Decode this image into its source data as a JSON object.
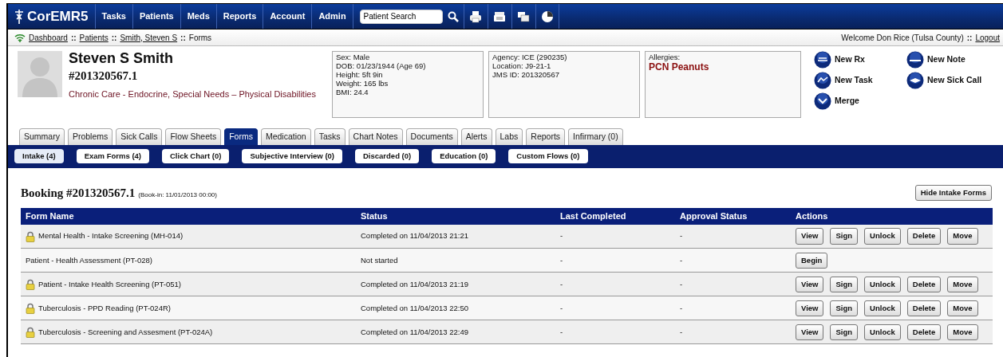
{
  "app": {
    "logo": "CorEMR5"
  },
  "nav": [
    {
      "label": "Tasks"
    },
    {
      "label": "Patients"
    },
    {
      "label": "Meds"
    },
    {
      "label": "Reports"
    },
    {
      "label": "Account"
    },
    {
      "label": "Admin"
    }
  ],
  "search": {
    "placeholder": "Patient Search"
  },
  "toolbar": [
    {
      "kind": "print"
    },
    {
      "kind": "fax"
    },
    {
      "kind": "queue"
    },
    {
      "kind": "stats"
    }
  ],
  "breadcrumb": [
    {
      "label": "Dashboard",
      "link": true
    },
    {
      "label": "Patients",
      "link": true
    },
    {
      "label": "Smith, Steven S",
      "link": true
    },
    {
      "label": "Forms",
      "link": false
    }
  ],
  "breadcrumb_separator": "::",
  "user": {
    "welcome": "Welcome Don Rice (Tulsa County)",
    "separator": "::",
    "logout": "Logout"
  },
  "patient": {
    "name": "Steven S Smith",
    "number": "#201320567.1",
    "conditions": "Chronic Care - Endocrine, Special Needs – Physical Disabilities"
  },
  "info_boxes": [
    {
      "lines": [
        "Sex: Male",
        "DOB: 01/23/1944 (Age 69)",
        "Height: 5ft 9in",
        "Weight: 165 lbs",
        "BMI: 24.4"
      ]
    },
    {
      "lines": [
        "Agency: ICE (290235)",
        "Location: J9-21-1",
        "JMS ID: 201320567"
      ]
    }
  ],
  "allergies": {
    "label": "Allergies:",
    "value": "PCN Peanuts"
  },
  "quick_actions": [
    {
      "label": "New Rx",
      "kind": "rx"
    },
    {
      "label": "New Note",
      "kind": "note"
    },
    {
      "label": "New Task",
      "kind": "task"
    },
    {
      "label": "New Sick Call",
      "kind": "sick"
    },
    {
      "label": "Merge",
      "kind": "merge"
    }
  ],
  "tabs": [
    {
      "label": "Summary",
      "selected": false
    },
    {
      "label": "Problems",
      "selected": false
    },
    {
      "label": "Sick Calls",
      "selected": false
    },
    {
      "label": "Flow Sheets",
      "selected": false
    },
    {
      "label": "Forms",
      "selected": true
    },
    {
      "label": "Medication",
      "selected": false
    },
    {
      "label": "Tasks",
      "selected": false
    },
    {
      "label": "Chart Notes",
      "selected": false
    },
    {
      "label": "Documents",
      "selected": false
    },
    {
      "label": "Alerts",
      "selected": false
    },
    {
      "label": "Labs",
      "selected": false
    },
    {
      "label": "Reports",
      "selected": false
    },
    {
      "label": "Infirmary (0)",
      "selected": false
    }
  ],
  "subtabs": [
    {
      "label": "Intake (4)",
      "selected": true
    },
    {
      "label": "Exam Forms (4)",
      "selected": false
    },
    {
      "label": "Click Chart (0)",
      "selected": false
    },
    {
      "label": "Subjective Interview (0)",
      "selected": false
    },
    {
      "label": "Discarded (0)",
      "selected": false
    },
    {
      "label": "Education (0)",
      "selected": false
    },
    {
      "label": "Custom Flows (0)",
      "selected": false
    }
  ],
  "booking": {
    "title": "Booking #201320567.1",
    "bookin": "(Book-in: 11/01/2013 00:00)",
    "hide_button": "Hide Intake Forms"
  },
  "table": {
    "columns": [
      "Form Name",
      "Status",
      "Last Completed",
      "Approval Status",
      "Actions"
    ],
    "rows": [
      {
        "name": "Mental Health - Intake Screening (MH-014)",
        "locked": true,
        "status": "Completed on 11/04/2013 21:21",
        "last_completed": "-",
        "approval": "-",
        "actions": [
          "View",
          "Sign",
          "Unlock",
          "Delete",
          "Move"
        ]
      },
      {
        "name": "Patient - Health Assessment (PT-028)",
        "locked": false,
        "status": "Not started",
        "last_completed": "-",
        "approval": "-",
        "actions": [
          "Begin"
        ]
      },
      {
        "name": "Patient - Intake Health Screening (PT-051)",
        "locked": true,
        "status": "Completed on 11/04/2013 21:19",
        "last_completed": "-",
        "approval": "-",
        "actions": [
          "View",
          "Sign",
          "Unlock",
          "Delete",
          "Move"
        ]
      },
      {
        "name": "Tuberculosis - PPD Reading (PT-024R)",
        "locked": true,
        "status": "Completed on 11/04/2013 22:50",
        "last_completed": "-",
        "approval": "-",
        "actions": [
          "View",
          "Sign",
          "Unlock",
          "Delete",
          "Move"
        ]
      },
      {
        "name": "Tuberculosis - Screening and Assesment (PT-024A)",
        "locked": true,
        "status": "Completed on 11/04/2013 22:49",
        "last_completed": "-",
        "approval": "-",
        "actions": [
          "View",
          "Sign",
          "Unlock",
          "Delete",
          "Move"
        ]
      }
    ]
  }
}
